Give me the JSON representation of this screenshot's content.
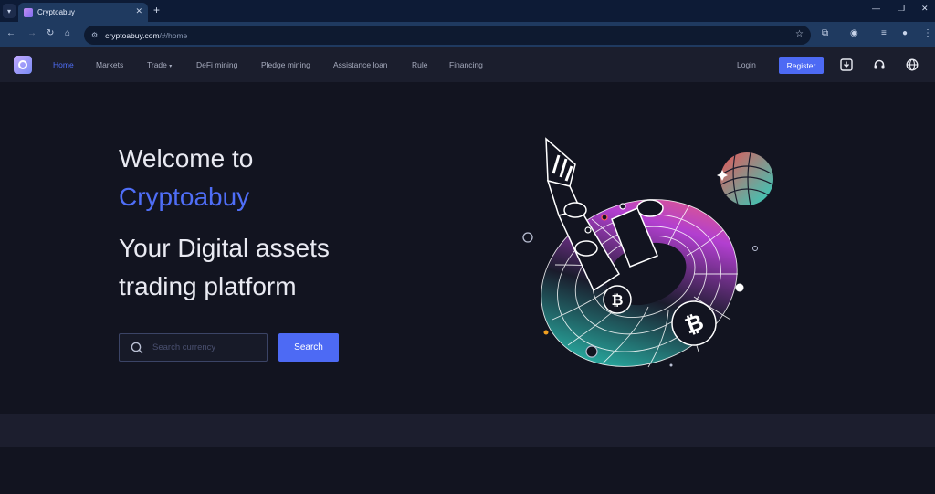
{
  "browser": {
    "tab_title": "Cryptoabuy",
    "url_host": "cryptoabuy.com",
    "url_path": "/#/home"
  },
  "nav": {
    "links": [
      "Home",
      "Markets",
      "Trade",
      "DeFi mining",
      "Pledge mining",
      "Assistance loan",
      "Rule",
      "Financing"
    ],
    "login": "Login",
    "register": "Register"
  },
  "hero": {
    "welcome": "Welcome to",
    "brand": "Cryptoabuy",
    "tagline_line1": "Your Digital assets",
    "tagline_line2": "trading platform",
    "search_placeholder": "Search currency",
    "search_button": "Search"
  },
  "colors": {
    "accent": "#4f6ef7",
    "background": "#121420",
    "nav_background": "#1b1e2d"
  }
}
